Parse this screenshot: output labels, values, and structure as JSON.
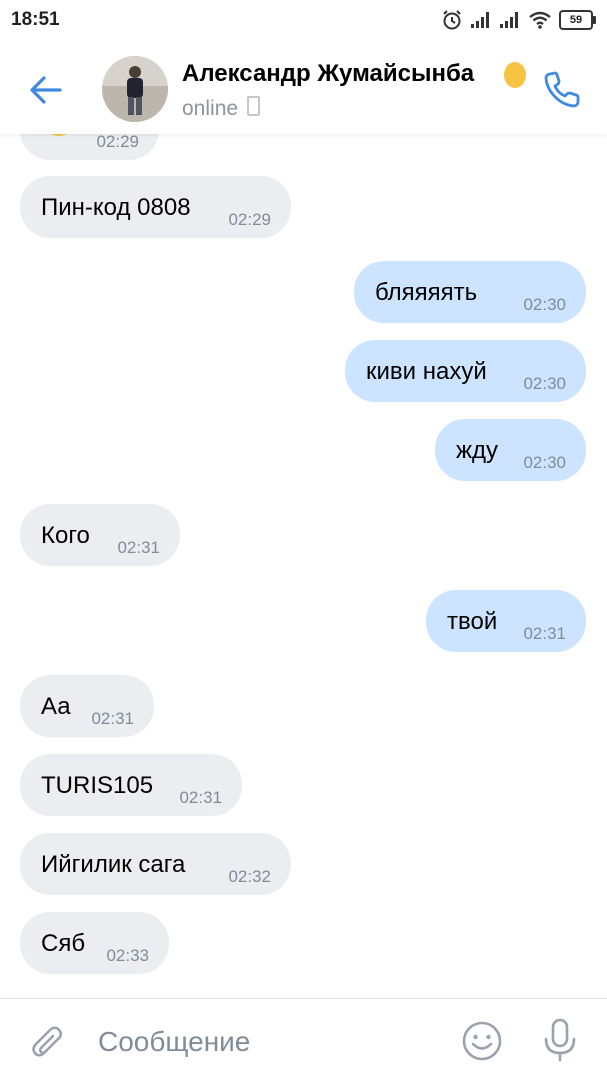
{
  "status_bar": {
    "time": "18:51",
    "battery": "59",
    "icons": [
      "alarm-icon",
      "signal-icon",
      "signal-icon",
      "wifi-icon",
      "battery-icon"
    ]
  },
  "header": {
    "contact_name": "Александр Жумайсынба",
    "status": "online",
    "icons": [
      "back-arrow-icon",
      "avatar",
      "phone-device-icon",
      "call-icon"
    ]
  },
  "messages": [
    {
      "direction": "in",
      "text": "",
      "time": "02:29",
      "emoji": "smile-emoji"
    },
    {
      "direction": "in",
      "text": "Пин-код 0808",
      "time": "02:29"
    },
    {
      "direction": "out",
      "text": "бляяяять",
      "time": "02:30"
    },
    {
      "direction": "out",
      "text": "киви нахуй",
      "time": "02:30"
    },
    {
      "direction": "out",
      "text": "жду",
      "time": "02:30"
    },
    {
      "direction": "in",
      "text": "Кого",
      "time": "02:31"
    },
    {
      "direction": "out",
      "text": "твой",
      "time": "02:31"
    },
    {
      "direction": "in",
      "text": "Аа",
      "time": "02:31"
    },
    {
      "direction": "in",
      "text": "TURIS105",
      "time": "02:31"
    },
    {
      "direction": "in",
      "text": "Ийгилик сага",
      "time": "02:32"
    },
    {
      "direction": "in",
      "text": "Сяб",
      "time": "02:33"
    }
  ],
  "composer": {
    "placeholder": "Сообщение",
    "value": "",
    "icons": [
      "attach-icon",
      "emoji-icon",
      "microphone-icon"
    ]
  },
  "colors": {
    "accent": "#3f8ae0",
    "incoming_bubble": "#ebedf0",
    "outgoing_bubble": "#cce4ff",
    "timestamp": "#818c99"
  }
}
